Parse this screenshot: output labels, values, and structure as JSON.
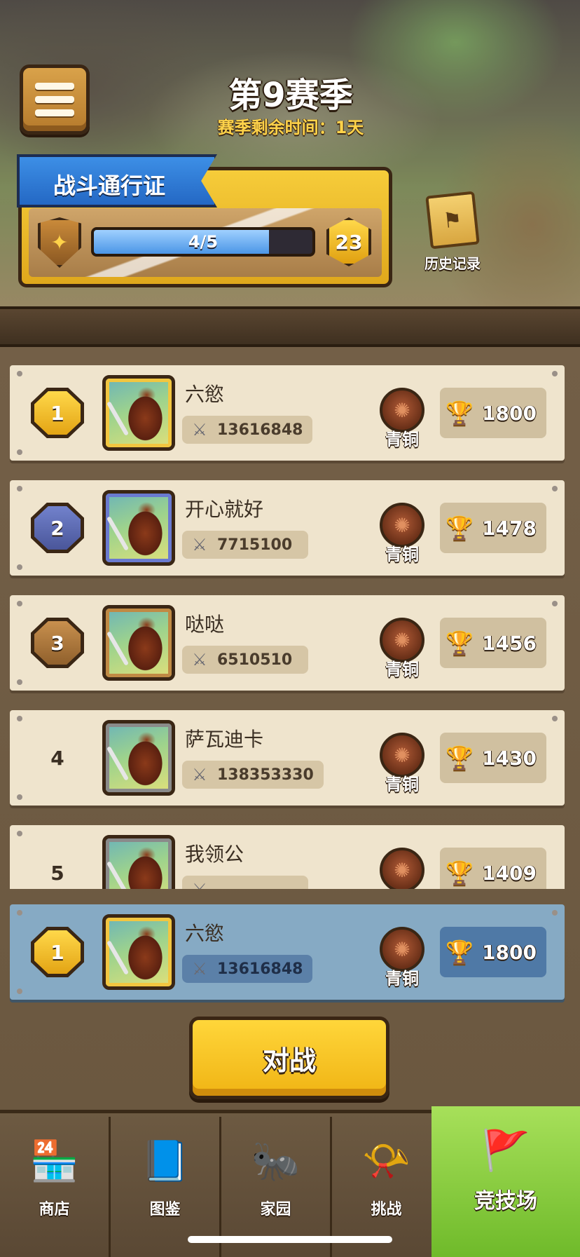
{
  "header": {
    "season_title": "第9赛季",
    "season_remaining": "赛季剩余时间：1天"
  },
  "battle_pass": {
    "title": "战斗通行证",
    "progress_text": "4/5",
    "progress_fraction": 0.8,
    "level": "23"
  },
  "history": {
    "label": "历史记录"
  },
  "leaderboard": {
    "rows": [
      {
        "rank": "1",
        "name": "六慾",
        "power": "13616848",
        "tier": "青铜",
        "trophies": "1800"
      },
      {
        "rank": "2",
        "name": "开心就好",
        "power": "7715100",
        "tier": "青铜",
        "trophies": "1478"
      },
      {
        "rank": "3",
        "name": "哒哒",
        "power": "6510510",
        "tier": "青铜",
        "trophies": "1456"
      },
      {
        "rank": "4",
        "name": "萨瓦迪卡",
        "power": "138353330",
        "tier": "青铜",
        "trophies": "1430"
      },
      {
        "rank": "5",
        "name": "我领公",
        "power": "",
        "tier": "青铜",
        "trophies": "1409"
      }
    ],
    "self": {
      "rank": "1",
      "name": "六慾",
      "power": "13616848",
      "tier": "青铜",
      "trophies": "1800"
    }
  },
  "battle_button": {
    "label": "对战"
  },
  "nav": {
    "items": [
      {
        "label": "商店",
        "icon": "shop-icon"
      },
      {
        "label": "图鉴",
        "icon": "book-icon"
      },
      {
        "label": "家园",
        "icon": "home-icon"
      },
      {
        "label": "挑战",
        "icon": "horn-icon"
      },
      {
        "label": "竞技场",
        "icon": "arena-banner-icon"
      }
    ]
  },
  "colors": {
    "gold_badge": "#f2c640",
    "silver_badge": "#5a6ab0",
    "bronze_badge": "#b07a40",
    "self_row": "#86aac4",
    "battle_button": "#ffd63a",
    "active_nav": "#8fd044"
  }
}
